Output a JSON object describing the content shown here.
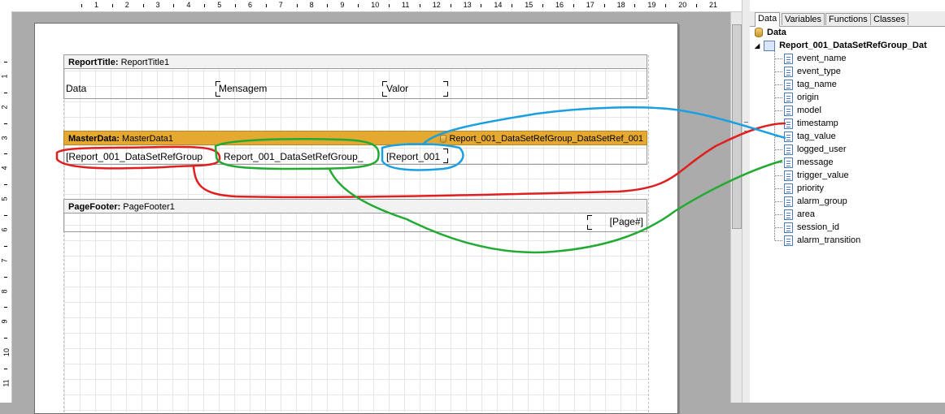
{
  "ruler": {
    "top_numbers": [
      "1",
      "2",
      "3",
      "4",
      "5",
      "6",
      "7",
      "8",
      "9",
      "10",
      "11",
      "12",
      "13",
      "14",
      "15",
      "16",
      "17",
      "18",
      "19",
      "20",
      "21",
      "2"
    ],
    "left_numbers": [
      "1",
      "2",
      "3",
      "4",
      "5",
      "6",
      "7",
      "8",
      "9",
      "10",
      "11"
    ]
  },
  "report": {
    "title_band": {
      "type": "ReportTitle:",
      "name": "ReportTitle1",
      "columns": [
        "Data",
        "Mensagem",
        "Valor"
      ]
    },
    "master_band": {
      "type": "MasterData:",
      "name": "MasterData1",
      "datasource": "Report_001_DataSetRefGroup_DataSetRef_001",
      "cells": [
        "[Report_001_DataSetRefGroup",
        "Report_001_DataSetRefGroup_",
        "[Report_001"
      ]
    },
    "footer_band": {
      "type": "PageFooter:",
      "name": "PageFooter1",
      "cells": [
        "[Page#]"
      ]
    }
  },
  "panel": {
    "tabs": [
      "Data",
      "Variables",
      "Functions",
      "Classes"
    ],
    "active_tab": "Data",
    "root": "Data",
    "dataset": "Report_001_DataSetRefGroup_Dat",
    "fields": [
      "event_name",
      "event_type",
      "tag_name",
      "origin",
      "model",
      "timestamp",
      "tag_value",
      "logged_user",
      "message",
      "trigger_value",
      "priority",
      "alarm_group",
      "area",
      "session_id",
      "alarm_transition"
    ]
  },
  "annotations": {
    "red": "#e02020",
    "green": "#22aa33",
    "blue": "#1a9fe0"
  },
  "colors": {
    "masterdata_band": "#e5a931",
    "band_header": "#f2f2f2"
  }
}
